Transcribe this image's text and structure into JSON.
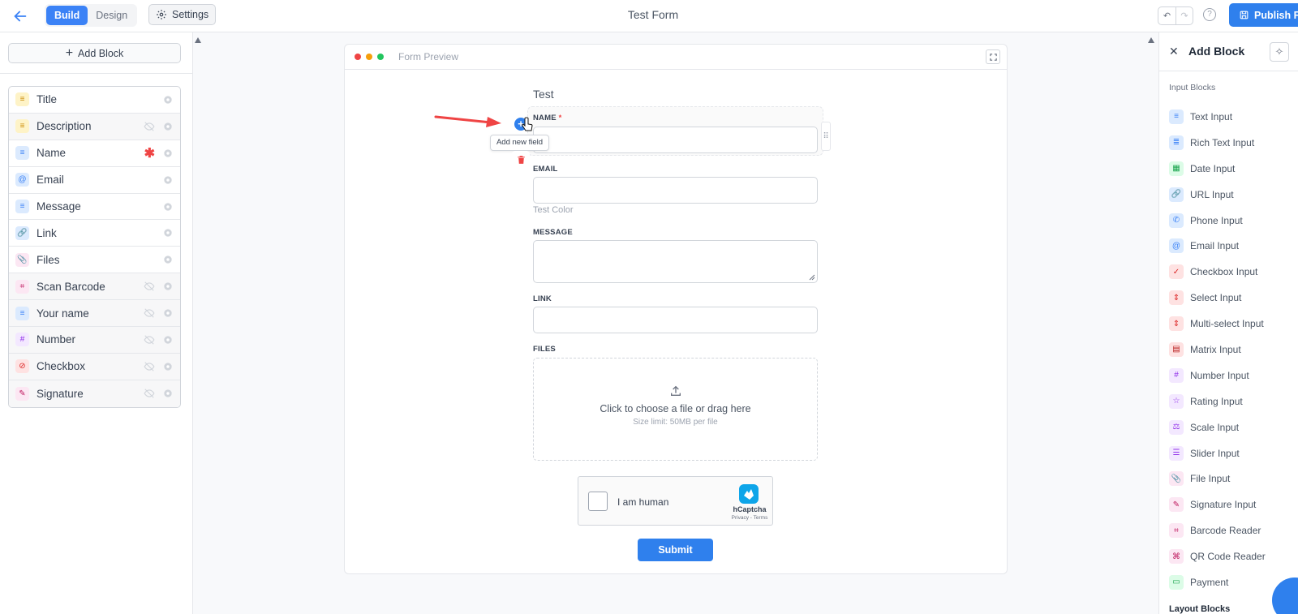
{
  "header": {
    "back_icon": "arrow-left-icon",
    "tabs": [
      {
        "label": "Build",
        "active": true
      },
      {
        "label": "Design",
        "active": false
      }
    ],
    "settings_label": "Settings",
    "form_title": "Test Form",
    "publish_label": "Publish Fo"
  },
  "sidebar": {
    "add_block_label": "Add Block",
    "blocks": [
      {
        "label": "Title",
        "icon": "text-lines-icon",
        "bg": "#fef3c7",
        "fg": "#ca8a04",
        "glyph": "≡",
        "hidden": false,
        "required": false
      },
      {
        "label": "Description",
        "icon": "text-lines-icon",
        "bg": "#fef3c7",
        "fg": "#ca8a04",
        "glyph": "≡",
        "hidden": true,
        "required": false
      },
      {
        "label": "Name",
        "icon": "text-input-icon",
        "bg": "#dbeafe",
        "fg": "#3b82f6",
        "glyph": "≡",
        "hidden": false,
        "required": true
      },
      {
        "label": "Email",
        "icon": "at-icon",
        "bg": "#dbeafe",
        "fg": "#3b82f6",
        "glyph": "@",
        "hidden": false,
        "required": false
      },
      {
        "label": "Message",
        "icon": "text-input-icon",
        "bg": "#dbeafe",
        "fg": "#3b82f6",
        "glyph": "≡",
        "hidden": false,
        "required": false
      },
      {
        "label": "Link",
        "icon": "link-icon",
        "bg": "#dbeafe",
        "fg": "#3b82f6",
        "glyph": "🔗",
        "hidden": false,
        "required": false
      },
      {
        "label": "Files",
        "icon": "paperclip-icon",
        "bg": "#fce7f3",
        "fg": "#db2777",
        "glyph": "📎",
        "hidden": false,
        "required": false
      },
      {
        "label": "Scan Barcode",
        "icon": "barcode-icon",
        "bg": "#fce7f3",
        "fg": "#be185d",
        "glyph": "⌗",
        "hidden": true,
        "required": false
      },
      {
        "label": "Your name",
        "icon": "text-input-icon",
        "bg": "#dbeafe",
        "fg": "#3b82f6",
        "glyph": "≡",
        "hidden": true,
        "required": false
      },
      {
        "label": "Number",
        "icon": "hash-icon",
        "bg": "#f3e8ff",
        "fg": "#9333ea",
        "glyph": "#",
        "hidden": true,
        "required": false
      },
      {
        "label": "Checkbox",
        "icon": "check-circle-icon",
        "bg": "#fee2e2",
        "fg": "#dc2626",
        "glyph": "⊘",
        "hidden": true,
        "required": false
      },
      {
        "label": "Signature",
        "icon": "signature-icon",
        "bg": "#fce7f3",
        "fg": "#be185d",
        "glyph": "✎",
        "hidden": true,
        "required": false
      }
    ]
  },
  "preview": {
    "window_label": "Form Preview",
    "form_heading": "Test",
    "tooltip": "Add new field",
    "fields": {
      "name_label": "NAME",
      "email_label": "EMAIL",
      "email_helper": "Test Color",
      "message_label": "MESSAGE",
      "link_label": "LINK",
      "files_label": "FILES"
    },
    "dropzone": {
      "main": "Click to choose a file or drag here",
      "sub": "Size limit: 50MB per file"
    },
    "captcha": {
      "text": "I am human",
      "brand": "hCaptcha",
      "links": "Privacy - Terms"
    },
    "submit_label": "Submit"
  },
  "right_panel": {
    "title": "Add Block",
    "section_input": "Input Blocks",
    "section_layout": "Layout Blocks",
    "items": [
      {
        "label": "Text Input",
        "bg": "#dbeafe",
        "fg": "#3b82f6",
        "glyph": "≡",
        "icon": "text-input-icon"
      },
      {
        "label": "Rich Text Input",
        "bg": "#dbeafe",
        "fg": "#3b82f6",
        "glyph": "≣",
        "icon": "rich-text-icon"
      },
      {
        "label": "Date Input",
        "bg": "#dcfce7",
        "fg": "#16a34a",
        "glyph": "▦",
        "icon": "calendar-icon"
      },
      {
        "label": "URL Input",
        "bg": "#dbeafe",
        "fg": "#3b82f6",
        "glyph": "🔗",
        "icon": "link-icon"
      },
      {
        "label": "Phone Input",
        "bg": "#dbeafe",
        "fg": "#3b82f6",
        "glyph": "✆",
        "icon": "phone-icon"
      },
      {
        "label": "Email Input",
        "bg": "#dbeafe",
        "fg": "#3b82f6",
        "glyph": "@",
        "icon": "at-icon"
      },
      {
        "label": "Checkbox Input",
        "bg": "#fee2e2",
        "fg": "#dc2626",
        "glyph": "✓",
        "icon": "check-circle-icon"
      },
      {
        "label": "Select Input",
        "bg": "#fee2e2",
        "fg": "#dc2626",
        "glyph": "⇕",
        "icon": "select-icon"
      },
      {
        "label": "Multi-select Input",
        "bg": "#fee2e2",
        "fg": "#dc2626",
        "glyph": "⇕",
        "icon": "multi-select-icon"
      },
      {
        "label": "Matrix Input",
        "bg": "#fee2e2",
        "fg": "#b91c1c",
        "glyph": "▤",
        "icon": "matrix-icon"
      },
      {
        "label": "Number Input",
        "bg": "#f3e8ff",
        "fg": "#9333ea",
        "glyph": "#",
        "icon": "hash-icon"
      },
      {
        "label": "Rating Input",
        "bg": "#f3e8ff",
        "fg": "#9333ea",
        "glyph": "☆",
        "icon": "star-icon"
      },
      {
        "label": "Scale Input",
        "bg": "#f3e8ff",
        "fg": "#9333ea",
        "glyph": "⚖",
        "icon": "scale-icon"
      },
      {
        "label": "Slider Input",
        "bg": "#f3e8ff",
        "fg": "#9333ea",
        "glyph": "☰",
        "icon": "slider-icon"
      },
      {
        "label": "File Input",
        "bg": "#fce7f3",
        "fg": "#db2777",
        "glyph": "📎",
        "icon": "paperclip-icon"
      },
      {
        "label": "Signature Input",
        "bg": "#fce7f3",
        "fg": "#be185d",
        "glyph": "✎",
        "icon": "signature-icon"
      },
      {
        "label": "Barcode Reader",
        "bg": "#fce7f3",
        "fg": "#be185d",
        "glyph": "⌗",
        "icon": "barcode-icon"
      },
      {
        "label": "QR Code Reader",
        "bg": "#fce7f3",
        "fg": "#be185d",
        "glyph": "⌘",
        "icon": "qr-code-icon"
      },
      {
        "label": "Payment",
        "bg": "#dcfce7",
        "fg": "#16a34a",
        "glyph": "▭",
        "icon": "credit-card-icon"
      }
    ]
  }
}
